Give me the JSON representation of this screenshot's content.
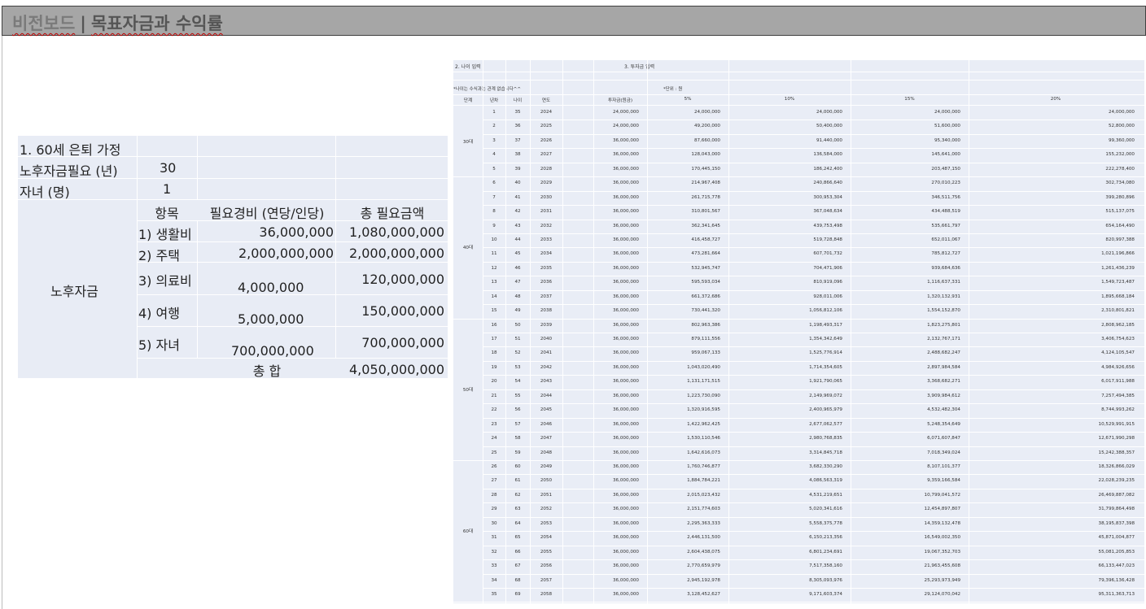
{
  "title": {
    "brand": "비전보드",
    "separator": "|",
    "main": "목표자금과 수익률"
  },
  "plan": {
    "row1": "1. 60세 은퇴 가정",
    "years_label": "노후자금필요 (년)",
    "years_value": "30",
    "children_label": "자녀 (명)",
    "children_value": "1",
    "group_label": "노후자금",
    "headers": [
      "항목",
      "필요경비 (연당/인당)",
      "총 필요금액"
    ],
    "items": [
      {
        "name": "1) 생활비",
        "cost": "36,000,000",
        "total": "1,080,000,000"
      },
      {
        "name": "2) 주택",
        "cost": "2,000,000,000",
        "total": "2,000,000,000"
      },
      {
        "name": "3) 의료비",
        "cost": "4,000,000",
        "total": "120,000,000"
      },
      {
        "name": "4) 여행",
        "cost": "5,000,000",
        "total": "150,000,000"
      },
      {
        "name": "5) 자녀",
        "cost": "700,000,000",
        "total": "700,000,000"
      }
    ],
    "sum_label": "총 합",
    "sum_value": "4,050,000,000"
  },
  "projection": {
    "section_age": "2. 나이 입력",
    "section_invest": "3. 투자금 입력",
    "note_left": "*나이는 수식과는 관계 없습니다^^",
    "note_unit": "*단위 : 원",
    "headers": [
      "단계",
      "년차",
      "나이",
      "연도",
      "투자금(원금)",
      "5%",
      "10%",
      "15%",
      "20%"
    ],
    "stages": [
      "30대",
      "40대",
      "50대",
      "60대"
    ],
    "rows": [
      [
        "1",
        "35",
        "2024",
        "24,000,000",
        "24,000,000",
        "24,000,000",
        "24,000,000",
        "24,000,000"
      ],
      [
        "2",
        "36",
        "2025",
        "24,000,000",
        "49,200,000",
        "50,400,000",
        "51,600,000",
        "52,800,000"
      ],
      [
        "3",
        "37",
        "2026",
        "36,000,000",
        "87,660,000",
        "91,440,000",
        "95,340,000",
        "99,360,000"
      ],
      [
        "4",
        "38",
        "2027",
        "36,000,000",
        "128,043,000",
        "136,584,000",
        "145,641,000",
        "155,232,000"
      ],
      [
        "5",
        "39",
        "2028",
        "36,000,000",
        "170,445,150",
        "186,242,400",
        "203,487,150",
        "222,278,400"
      ],
      [
        "6",
        "40",
        "2029",
        "36,000,000",
        "214,967,408",
        "240,866,640",
        "270,010,223",
        "302,734,080"
      ],
      [
        "7",
        "41",
        "2030",
        "36,000,000",
        "261,715,778",
        "300,953,304",
        "346,511,756",
        "399,280,896"
      ],
      [
        "8",
        "42",
        "2031",
        "36,000,000",
        "310,801,567",
        "367,048,634",
        "434,488,519",
        "515,137,075"
      ],
      [
        "9",
        "43",
        "2032",
        "36,000,000",
        "362,341,645",
        "439,753,498",
        "535,661,797",
        "654,164,490"
      ],
      [
        "10",
        "44",
        "2033",
        "36,000,000",
        "416,458,727",
        "519,728,848",
        "652,011,067",
        "820,997,388"
      ],
      [
        "11",
        "45",
        "2034",
        "36,000,000",
        "473,281,664",
        "607,701,732",
        "785,812,727",
        "1,021,196,866"
      ],
      [
        "12",
        "46",
        "2035",
        "36,000,000",
        "532,945,747",
        "704,471,906",
        "939,684,636",
        "1,261,436,239"
      ],
      [
        "13",
        "47",
        "2036",
        "36,000,000",
        "595,593,034",
        "810,919,096",
        "1,116,637,331",
        "1,549,723,487"
      ],
      [
        "14",
        "48",
        "2037",
        "36,000,000",
        "661,372,686",
        "928,011,006",
        "1,320,132,931",
        "1,895,668,184"
      ],
      [
        "15",
        "49",
        "2038",
        "36,000,000",
        "730,441,320",
        "1,056,812,106",
        "1,554,152,870",
        "2,310,801,821"
      ],
      [
        "16",
        "50",
        "2039",
        "36,000,000",
        "802,963,386",
        "1,198,493,317",
        "1,823,275,801",
        "2,808,962,185"
      ],
      [
        "17",
        "51",
        "2040",
        "36,000,000",
        "879,111,556",
        "1,354,342,649",
        "2,132,767,171",
        "3,406,754,623"
      ],
      [
        "18",
        "52",
        "2041",
        "36,000,000",
        "959,067,133",
        "1,525,776,914",
        "2,488,682,247",
        "4,124,105,547"
      ],
      [
        "19",
        "53",
        "2042",
        "36,000,000",
        "1,043,020,490",
        "1,714,354,605",
        "2,897,984,584",
        "4,984,926,656"
      ],
      [
        "20",
        "54",
        "2043",
        "36,000,000",
        "1,131,171,515",
        "1,921,790,065",
        "3,368,682,271",
        "6,017,911,988"
      ],
      [
        "21",
        "55",
        "2044",
        "36,000,000",
        "1,223,730,090",
        "2,149,969,072",
        "3,909,984,612",
        "7,257,494,385"
      ],
      [
        "22",
        "56",
        "2045",
        "36,000,000",
        "1,320,916,595",
        "2,400,965,979",
        "4,532,482,304",
        "8,744,993,262"
      ],
      [
        "23",
        "57",
        "2046",
        "36,000,000",
        "1,422,962,425",
        "2,677,062,577",
        "5,248,354,649",
        "10,529,991,915"
      ],
      [
        "24",
        "58",
        "2047",
        "36,000,000",
        "1,530,110,546",
        "2,980,768,835",
        "6,071,607,847",
        "12,671,990,298"
      ],
      [
        "25",
        "59",
        "2048",
        "36,000,000",
        "1,642,616,073",
        "3,314,845,718",
        "7,018,349,024",
        "15,242,388,357"
      ],
      [
        "26",
        "60",
        "2049",
        "36,000,000",
        "1,760,746,877",
        "3,682,330,290",
        "8,107,101,377",
        "18,326,866,029"
      ],
      [
        "27",
        "61",
        "2050",
        "36,000,000",
        "1,884,784,221",
        "4,086,563,319",
        "9,359,166,584",
        "22,028,239,235"
      ],
      [
        "28",
        "62",
        "2051",
        "36,000,000",
        "2,015,023,432",
        "4,531,219,651",
        "10,799,041,572",
        "26,469,887,082"
      ],
      [
        "29",
        "63",
        "2052",
        "36,000,000",
        "2,151,774,603",
        "5,020,341,616",
        "12,454,897,807",
        "31,799,864,498"
      ],
      [
        "30",
        "64",
        "2053",
        "36,000,000",
        "2,295,363,333",
        "5,558,375,778",
        "14,359,132,478",
        "38,195,837,398"
      ],
      [
        "31",
        "65",
        "2054",
        "36,000,000",
        "2,446,131,500",
        "6,150,213,356",
        "16,549,002,350",
        "45,871,004,877"
      ],
      [
        "32",
        "66",
        "2055",
        "36,000,000",
        "2,604,438,075",
        "6,801,234,691",
        "19,067,352,703",
        "55,081,205,853"
      ],
      [
        "33",
        "67",
        "2056",
        "36,000,000",
        "2,770,659,979",
        "7,517,358,160",
        "21,963,455,608",
        "66,133,447,023"
      ],
      [
        "34",
        "68",
        "2057",
        "36,000,000",
        "2,945,192,978",
        "8,305,093,976",
        "25,293,973,949",
        "79,396,136,428"
      ],
      [
        "35",
        "69",
        "2058",
        "36,000,000",
        "3,128,452,627",
        "9,171,603,374",
        "29,124,070,042",
        "95,311,363,713"
      ]
    ]
  }
}
